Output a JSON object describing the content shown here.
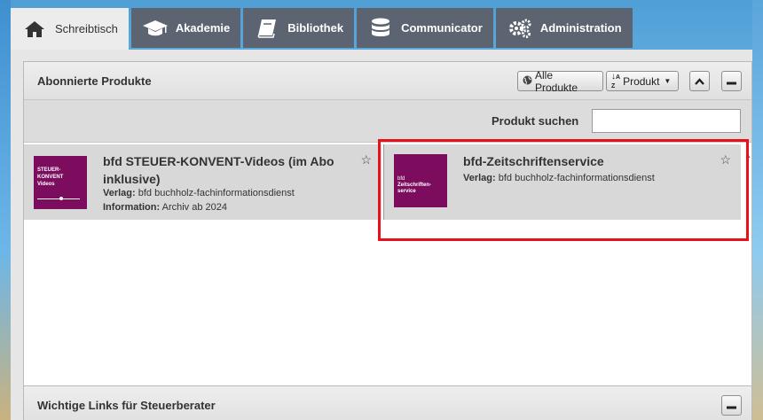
{
  "tabs": [
    {
      "label": "Schreibtisch",
      "icon": "home-icon",
      "active": true
    },
    {
      "label": "Akademie",
      "icon": "graduation-cap-icon"
    },
    {
      "label": "Bibliothek",
      "icon": "book-icon"
    },
    {
      "label": "Communicator",
      "icon": "database-icon"
    },
    {
      "label": "Administration",
      "icon": "gears-icon"
    }
  ],
  "panel": {
    "title": "Abonnierte Produkte",
    "btn_all": "Alle Produkte",
    "btn_sort": "Produkt",
    "search_label": "Produkt suchen",
    "search_value": ""
  },
  "products": [
    {
      "title": "bfd STEUER-KONVENT-Videos (im Abo inklusive)",
      "verlag_label": "Verlag:",
      "verlag": "bfd buchholz-fachinformationsdienst",
      "info_label": "Information:",
      "info": "Archiv ab 2024",
      "logo_lines": [
        "STEUER-",
        "KONVENT",
        "Videos"
      ]
    },
    {
      "title": "bfd-Zeitschriftenservice",
      "verlag_label": "Verlag:",
      "verlag": "bfd buchholz-fachinformationsdienst",
      "logo_lines": [
        "bfd",
        "Zeitschriften-",
        "service"
      ]
    }
  ],
  "panel2": {
    "title": "Wichtige Links für Steuerberater"
  },
  "colors": {
    "tab_bg": "#5b6470",
    "accent_logo": "#7b0c5e",
    "highlight": "#e8111a"
  }
}
